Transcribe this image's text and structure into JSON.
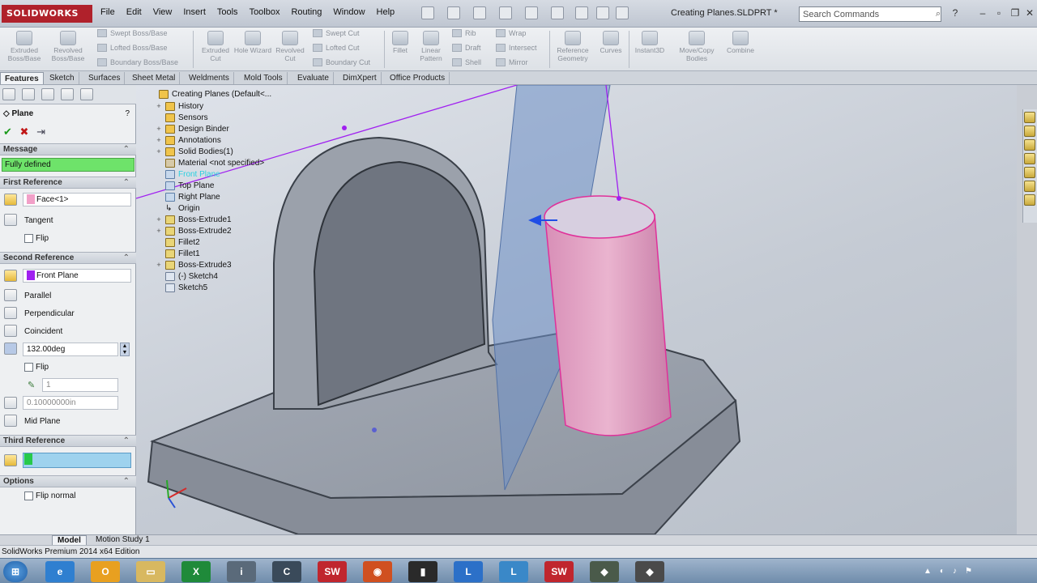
{
  "app": {
    "logo_text": "SOLIDWORKS",
    "document_title": "Creating Planes.SLDPRT *"
  },
  "menu": [
    "File",
    "Edit",
    "View",
    "Insert",
    "Tools",
    "Toolbox",
    "Routing",
    "Window",
    "Help"
  ],
  "search": {
    "placeholder": "Search Commands"
  },
  "command_manager": {
    "big_buttons": [
      "Extruded Boss/Base",
      "Revolved Boss/Base",
      "Extruded Cut",
      "Hole Wizard",
      "Revolved Cut",
      "Fillet",
      "Linear Pattern",
      "Reference Geometry",
      "Curves",
      "Instant3D",
      "Move/Copy Bodies",
      "Combine"
    ],
    "boss_rows": [
      "Swept Boss/Base",
      "Lofted Boss/Base",
      "Boundary Boss/Base"
    ],
    "cut_rows": [
      "Swept Cut",
      "Lofted Cut",
      "Boundary Cut"
    ],
    "misc_rows1": [
      "Rib",
      "Draft",
      "Shell"
    ],
    "misc_rows2": [
      "Wrap",
      "Intersect",
      "Mirror"
    ]
  },
  "tabs": [
    "Features",
    "Sketch",
    "Surfaces",
    "Sheet Metal",
    "Weldments",
    "Mold Tools",
    "Evaluate",
    "DimXpert",
    "Office Products"
  ],
  "property_manager": {
    "title": "Plane",
    "message": {
      "header": "Message",
      "text": "Fully defined"
    },
    "first_reference": {
      "header": "First Reference",
      "value": "Face<1>",
      "tangent": "Tangent",
      "flip": "Flip"
    },
    "second_reference": {
      "header": "Second Reference",
      "value": "Front Plane",
      "parallel": "Parallel",
      "perpendicular": "Perpendicular",
      "coincident": "Coincident",
      "angle": "132.00deg",
      "flip": "Flip",
      "count": "1",
      "distance": "0.10000000in",
      "mid_plane": "Mid Plane"
    },
    "third_reference": {
      "header": "Third Reference",
      "value": ""
    },
    "options": {
      "header": "Options",
      "flip_normal": "Flip normal"
    }
  },
  "feature_tree": {
    "root": "Creating Planes  (Default<...",
    "items": [
      "History",
      "Sensors",
      "Design Binder",
      "Annotations",
      "Solid Bodies(1)",
      "Material <not specified>",
      "Front Plane",
      "Top Plane",
      "Right Plane",
      "Origin",
      "Boss-Extrude1",
      "Boss-Extrude2",
      "Fillet2",
      "Fillet1",
      "Boss-Extrude3",
      "(-) Sketch4",
      "Sketch5"
    ]
  },
  "bottom_tabs": [
    "Model",
    "Motion Study 1"
  ],
  "status": {
    "text": "SolidWorks Premium 2014 x64 Edition"
  },
  "colors": {
    "accent_green": "#6ee36a",
    "face_pink": "#f2a0c8",
    "plane_purple": "#a020f0",
    "cylinder": "#e060a8",
    "plane_blue": "#6d8fc6"
  }
}
